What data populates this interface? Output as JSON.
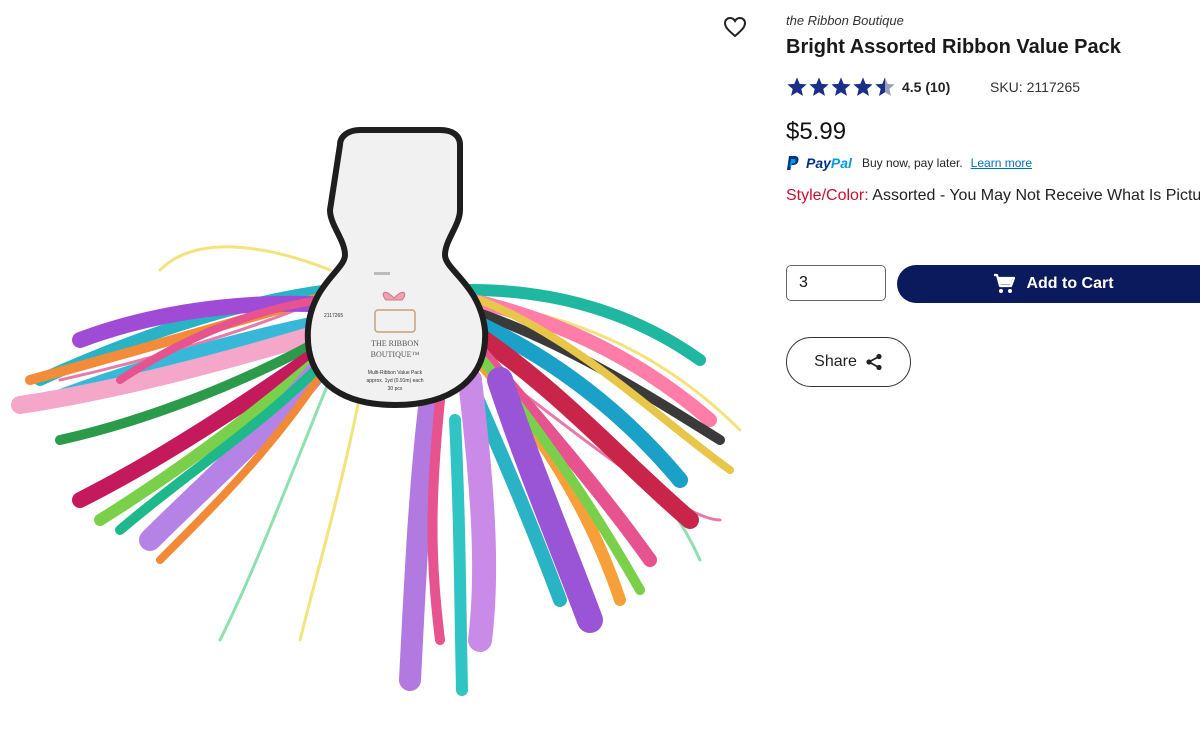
{
  "product": {
    "brand": "the Ribbon Boutique",
    "title": "Bright Assorted Ribbon Value Pack",
    "rating": 4.5,
    "rating_text": "4.5 (10)",
    "sku_text": "SKU: 2117265",
    "price": "$5.99"
  },
  "paypal": {
    "brand_pay": "Pay",
    "brand_pal": "Pal",
    "text": "Buy now, pay later.",
    "link": "Learn more"
  },
  "style_color": {
    "label": "Style/Color:",
    "value": "Assorted - You May Not Receive What Is Pictured"
  },
  "cart": {
    "quantity": "3",
    "add_label": "Add to Cart"
  },
  "share": {
    "label": "Share"
  },
  "image_card": {
    "sku": "2117265",
    "brand_line1": "THE RIBBON",
    "brand_line2": "BOUTIQUE™",
    "desc1": "Multi-Ribbon Value Pack",
    "desc2": "approx. 1yd (0.91m) each",
    "desc3": "30 pcs"
  },
  "colors": {
    "accent_navy": "#0a1a5c",
    "star_navy": "#1a2f85",
    "label_red": "#c8102e",
    "paypal_blue": "#003087",
    "paypal_light": "#009cde",
    "link_blue": "#0070ba"
  },
  "icons": {
    "favorite": "heart-outline-icon",
    "cart": "shopping-cart-icon",
    "share": "share-icon",
    "star": "star-icon"
  }
}
